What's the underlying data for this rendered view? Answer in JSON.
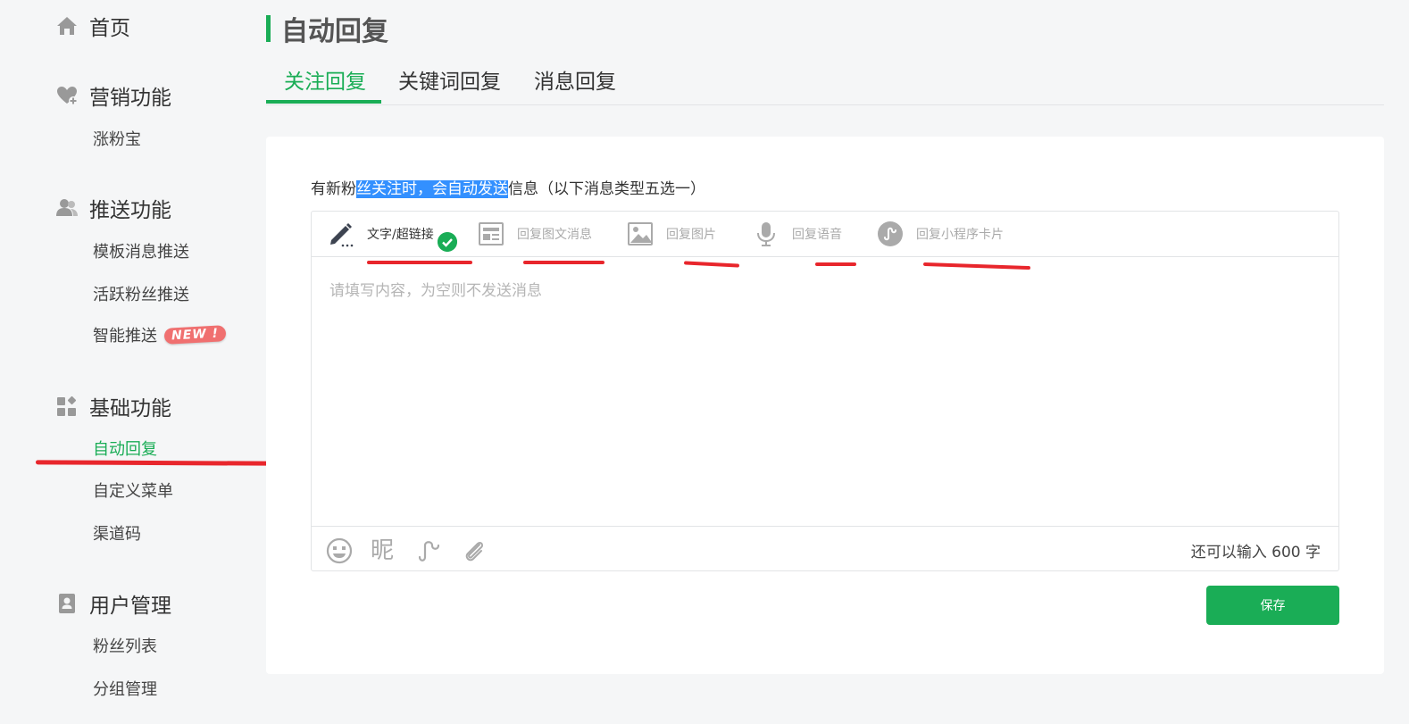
{
  "sidebar": {
    "home": {
      "label": "首页",
      "icon": "home-icon"
    },
    "groups": [
      {
        "label": "营销功能",
        "icon": "heart-plus-icon",
        "items": [
          {
            "label": "涨粉宝"
          }
        ]
      },
      {
        "label": "推送功能",
        "icon": "users-icon",
        "items": [
          {
            "label": "模板消息推送"
          },
          {
            "label": "活跃粉丝推送"
          },
          {
            "label": "智能推送",
            "badge": "NEW !"
          }
        ]
      },
      {
        "label": "基础功能",
        "icon": "grid-icon",
        "items": [
          {
            "label": "自动回复",
            "active": true
          },
          {
            "label": "自定义菜单"
          },
          {
            "label": "渠道码"
          }
        ]
      },
      {
        "label": "用户管理",
        "icon": "contact-card-icon",
        "items": [
          {
            "label": "粉丝列表"
          },
          {
            "label": "分组管理"
          }
        ]
      }
    ]
  },
  "header": {
    "title": "自动回复",
    "tabs": [
      {
        "label": "关注回复",
        "active": true
      },
      {
        "label": "关键词回复"
      },
      {
        "label": "消息回复"
      }
    ]
  },
  "main": {
    "description": {
      "before": "有新粉",
      "highlight": "丝关注时，会自动发送",
      "after": "信息（以下消息类型五选一）"
    },
    "reply_types": [
      {
        "label": "文字/超链接",
        "icon": "pencil-icon",
        "active": true
      },
      {
        "label": "回复图文消息",
        "icon": "news-icon"
      },
      {
        "label": "回复图片",
        "icon": "image-icon"
      },
      {
        "label": "回复语音",
        "icon": "microphone-icon"
      },
      {
        "label": "回复小程序卡片",
        "icon": "mini-program-icon"
      }
    ],
    "editor": {
      "placeholder": "请填写内容，为空则不发送消息",
      "value": ""
    },
    "toolbar": {
      "nickname_label": "昵",
      "counter": "还可以输入 600 字"
    },
    "save_label": "保存"
  },
  "colors": {
    "accent": "#1aad56",
    "highlight": "#3390ff",
    "annotation": "#e8262c",
    "badge": "#f07070"
  }
}
